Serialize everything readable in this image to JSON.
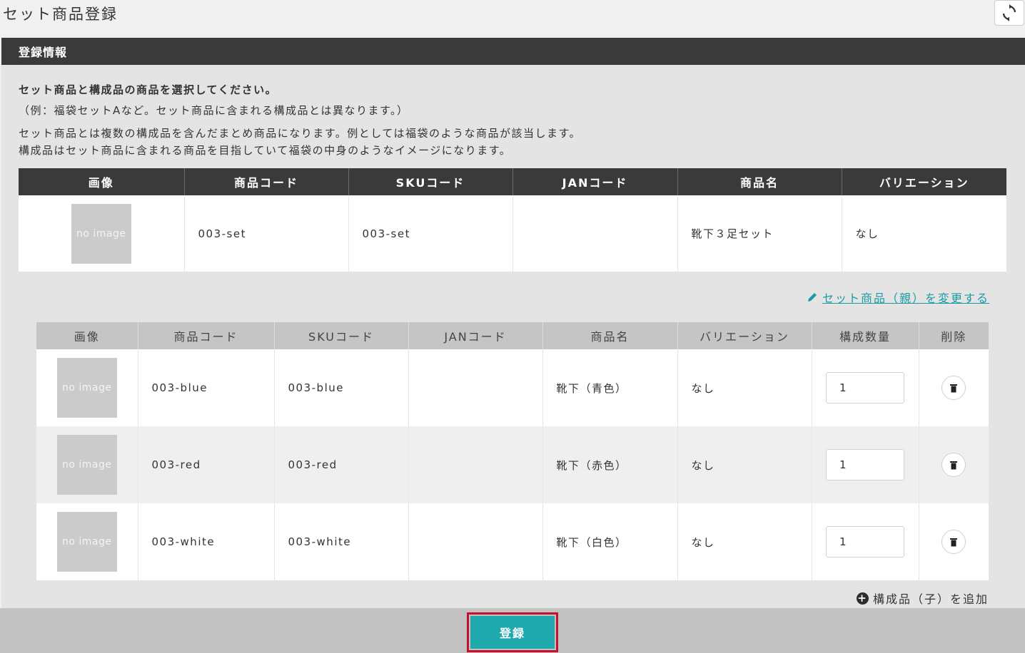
{
  "page": {
    "title": "セット商品登録"
  },
  "panel": {
    "title": "登録情報",
    "desc_bold": "セット商品と構成品の商品を選択してください。",
    "desc_example": "（例：福袋セットAなど。セット商品に含まれる構成品とは異なります。）",
    "desc_line1": "セット商品とは複数の構成品を含んだまとめ商品になります。例としては福袋のような商品が該当します。",
    "desc_line2": "構成品はセット商品に含まれる商品を目指していて福袋の中身のようなイメージになります。"
  },
  "parent_table": {
    "headers": [
      "画像",
      "商品コード",
      "SKUコード",
      "JANコード",
      "商品名",
      "バリエーション"
    ],
    "row": {
      "image": "no image",
      "product_code": "003-set",
      "sku_code": "003-set",
      "jan_code": "",
      "product_name": "靴下３足セット",
      "variation": "なし"
    }
  },
  "change_parent_link": "セット商品（親）を変更する",
  "child_table": {
    "headers": [
      "画像",
      "商品コード",
      "SKUコード",
      "JANコード",
      "商品名",
      "バリエーション",
      "構成数量",
      "削除"
    ],
    "rows": [
      {
        "image": "no image",
        "product_code": "003-blue",
        "sku_code": "003-blue",
        "jan_code": "",
        "product_name": "靴下（青色）",
        "variation": "なし",
        "quantity": "1"
      },
      {
        "image": "no image",
        "product_code": "003-red",
        "sku_code": "003-red",
        "jan_code": "",
        "product_name": "靴下（赤色）",
        "variation": "なし",
        "quantity": "1"
      },
      {
        "image": "no image",
        "product_code": "003-white",
        "sku_code": "003-white",
        "jan_code": "",
        "product_name": "靴下（白色）",
        "variation": "なし",
        "quantity": "1"
      }
    ]
  },
  "add_child_label": "構成品（子）を追加",
  "submit_label": "登録",
  "icons": {
    "refresh": "refresh-icon",
    "edit": "pencil-icon",
    "delete": "trash-icon",
    "add": "plus-circle-icon"
  },
  "colors": {
    "header_dark": "#3a3a3a",
    "accent_teal": "#1fa9ad",
    "link_teal": "#1a9aa2",
    "highlight_red": "#c8102e"
  }
}
